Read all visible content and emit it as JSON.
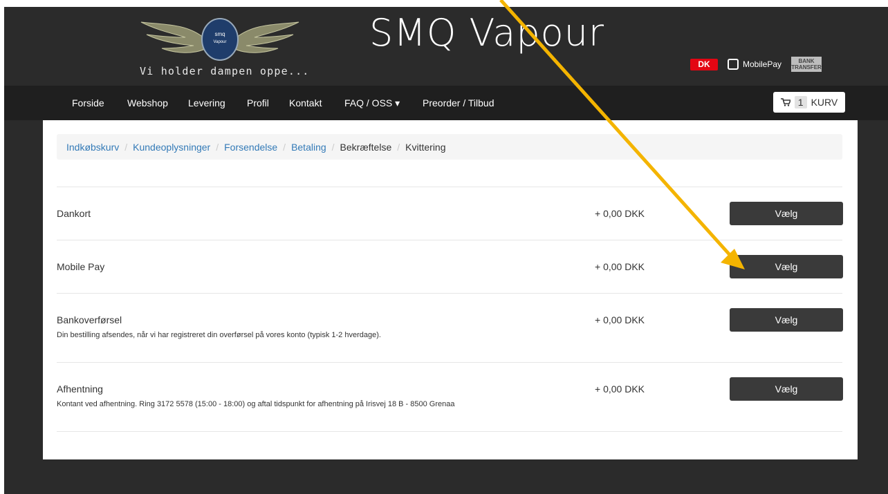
{
  "header": {
    "title": "SMQ Vapour",
    "tagline": "Vi holder dampen oppe...",
    "logo_text_top": "smq",
    "logo_text_bottom": "Vapour",
    "payment_logos": {
      "dankort": "DK",
      "mobilepay": "MobilePay",
      "bank_line1": "BANK",
      "bank_line2": "TRANSFER"
    }
  },
  "nav": {
    "items": [
      "Forside",
      "Webshop",
      "Levering",
      "Profil",
      "Kontakt",
      "FAQ / OSS ▾",
      "Preorder / Tilbud"
    ],
    "cart_count": "1",
    "cart_label": "KURV"
  },
  "breadcrumb": {
    "items": [
      "Indkøbskurv",
      "Kundeoplysninger",
      "Forsendelse",
      "Betaling",
      "Bekræftelse",
      "Kvittering"
    ],
    "separator": "/"
  },
  "payment_methods": [
    {
      "name": "Dankort",
      "description": "",
      "price": "+ 0,00 DKK",
      "button": "Vælg"
    },
    {
      "name": "Mobile Pay",
      "description": "",
      "price": "+ 0,00 DKK",
      "button": "Vælg"
    },
    {
      "name": "Bankoverførsel",
      "description": "Din bestilling afsendes, når vi har registreret din overførsel på vores konto (typisk 1-2 hverdage).",
      "price": "+ 0,00 DKK",
      "button": "Vælg"
    },
    {
      "name": "Afhentning",
      "description": "Kontant ved afhentning. Ring 3172 5578 (15:00 - 18:00) og aftal tidspunkt for afhentning på Irisvej 18 B - 8500 Grenaa",
      "price": "+ 0,00 DKK",
      "button": "Vælg"
    }
  ],
  "colors": {
    "header_bg": "#2b2b2b",
    "nav_bg": "#1f1f1f",
    "button_bg": "#3a3a3a",
    "link": "#337ab7",
    "arrow": "#f4b400"
  }
}
